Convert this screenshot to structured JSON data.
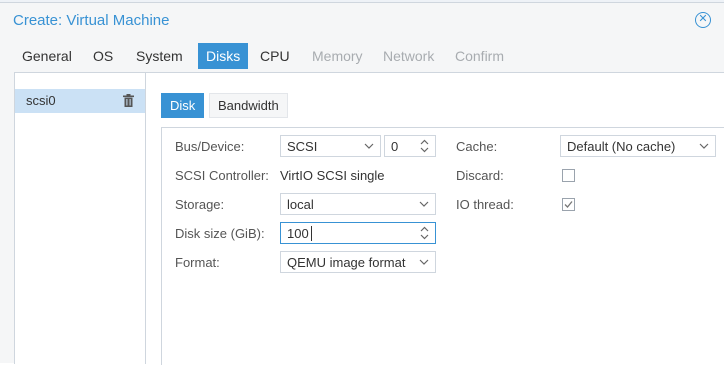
{
  "window": {
    "title": "Create: Virtual Machine"
  },
  "tabs": [
    {
      "label": "General",
      "state": "normal"
    },
    {
      "label": "OS",
      "state": "normal"
    },
    {
      "label": "System",
      "state": "normal"
    },
    {
      "label": "Disks",
      "state": "active"
    },
    {
      "label": "CPU",
      "state": "normal"
    },
    {
      "label": "Memory",
      "state": "disabled"
    },
    {
      "label": "Network",
      "state": "disabled"
    },
    {
      "label": "Confirm",
      "state": "disabled"
    }
  ],
  "disk_list": {
    "items": [
      {
        "label": "scsi0",
        "selected": true,
        "icon": "trash-icon"
      }
    ]
  },
  "subtabs": [
    {
      "label": "Disk",
      "active": true
    },
    {
      "label": "Bandwidth",
      "active": false
    }
  ],
  "form": {
    "bus_device": {
      "label": "Bus/Device:",
      "bus": "SCSI",
      "device": "0"
    },
    "scsi_controller": {
      "label": "SCSI Controller:",
      "value": "VirtIO SCSI single"
    },
    "storage": {
      "label": "Storage:",
      "value": "local"
    },
    "disk_size": {
      "label": "Disk size (GiB):",
      "value": "100"
    },
    "format": {
      "label": "Format:",
      "value": "QEMU image format"
    },
    "cache": {
      "label": "Cache:",
      "value": "Default (No cache)"
    },
    "discard": {
      "label": "Discard:",
      "checked": false
    },
    "io_thread": {
      "label": "IO thread:",
      "checked": true
    }
  },
  "colors": {
    "accent": "#3892d4",
    "selected_row": "#cbe1f5",
    "disabled_text": "#a8acb0"
  }
}
